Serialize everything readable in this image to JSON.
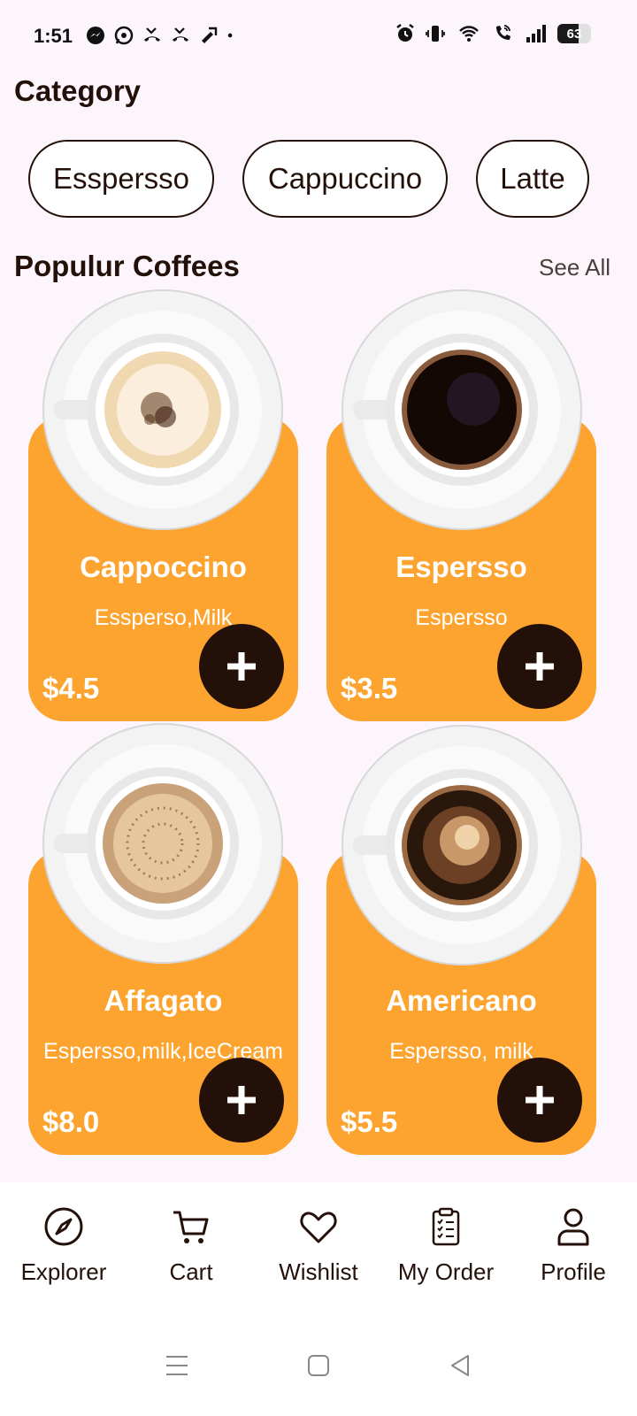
{
  "status_bar": {
    "time": "1:51",
    "battery": "63",
    "battery_level": 0.63,
    "left_icons": [
      "messenger-icon",
      "whatsapp-icon",
      "missed-call-icon",
      "missed-call-icon",
      "missed-call-icon",
      "dot-icon"
    ],
    "right_icons": [
      "alarm-icon",
      "vibrate-icon",
      "wifi-icon",
      "wifi-call-icon",
      "signal-icon",
      "battery-icon"
    ]
  },
  "category": {
    "title": "Category",
    "chips": [
      "Esspersso",
      "Cappuccino",
      "Latte"
    ]
  },
  "popular": {
    "title": "Populur Coffees",
    "see_all": "See All",
    "items": [
      {
        "name": "Cappoccino",
        "ingredients": "Essperso,Milk",
        "price": "$4.5",
        "image": "cappuccino-cup"
      },
      {
        "name": "Espersso",
        "ingredients": "Espersso",
        "price": "$3.5",
        "image": "espresso-cup"
      },
      {
        "name": "Affagato",
        "ingredients": "Espersso,milk,IceCream",
        "price": "$8.0",
        "image": "affogato-cup"
      },
      {
        "name": "Americano",
        "ingredients": "Espersso, milk",
        "price": "$5.5",
        "image": "americano-cup"
      }
    ]
  },
  "bottom_nav": {
    "items": [
      {
        "label": "Explorer",
        "icon": "compass-icon"
      },
      {
        "label": "Cart",
        "icon": "cart-icon"
      },
      {
        "label": "Wishlist",
        "icon": "heart-icon"
      },
      {
        "label": "My Order",
        "icon": "clipboard-icon"
      },
      {
        "label": "Profile",
        "icon": "person-icon"
      }
    ]
  },
  "system_nav": [
    "menu-icon",
    "home-icon",
    "back-icon"
  ],
  "colors": {
    "background": "#fcf5fb",
    "card": "#fca42f",
    "dark": "#231009",
    "text_light": "#ffffff"
  }
}
